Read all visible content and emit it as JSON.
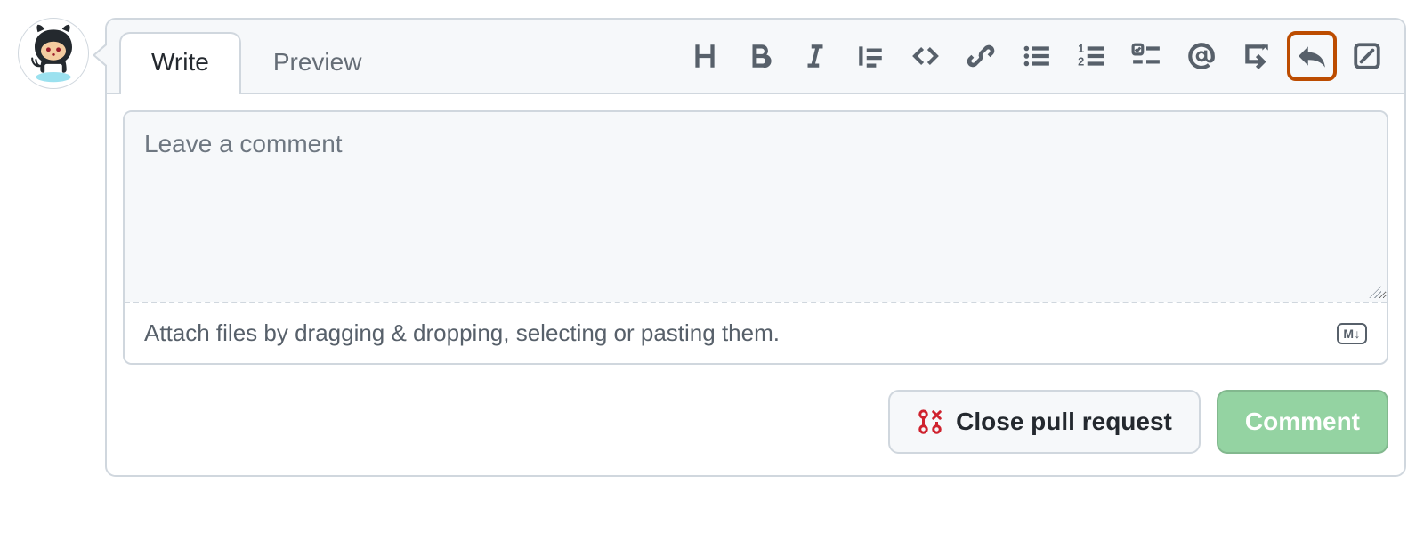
{
  "tabs": {
    "write": "Write",
    "preview": "Preview"
  },
  "toolbar_icons": {
    "heading": "heading",
    "bold": "bold",
    "italic": "italic",
    "quote": "quote",
    "code": "code",
    "link": "link",
    "ul": "unordered-list",
    "ol": "ordered-list",
    "task": "task-list",
    "mention": "mention",
    "crossref": "cross-reference",
    "reply": "reply",
    "suggest": "suggestion"
  },
  "textarea": {
    "placeholder": "Leave a comment",
    "value": ""
  },
  "attach_hint": "Attach files by dragging & dropping, selecting or pasting them.",
  "markdown_badge": "M↓",
  "buttons": {
    "close_pr": "Close pull request",
    "comment": "Comment"
  }
}
